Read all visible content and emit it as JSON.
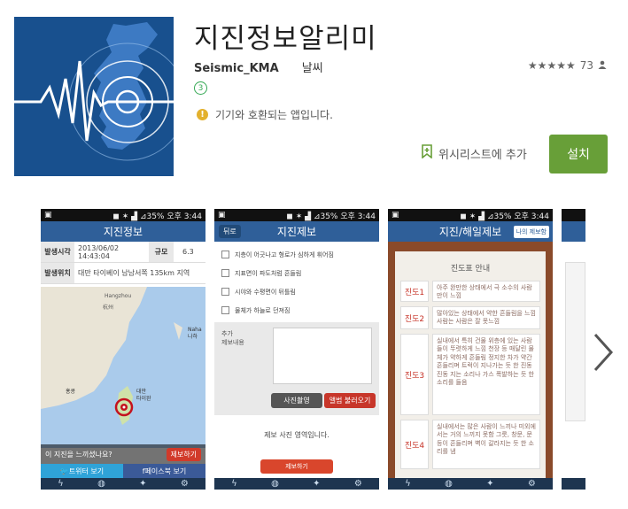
{
  "app": {
    "title": "지진정보알리미",
    "developer": "Seismic_KMA",
    "category": "날씨",
    "rating_stars": "★★★★★",
    "rating_count": "73",
    "age_rating": "3",
    "compat_text": "기기와 호환되는 앱입니다.",
    "wishlist_label": "위시리스트에 추가",
    "install_label": "설치"
  },
  "status_bar": {
    "signal": "◼ ✶ ▟ ⊿35%",
    "time": "오후 3:44"
  },
  "shot1": {
    "title": "지진정보",
    "rows": [
      {
        "label": "발생시각",
        "value": "2013/06/02 14:43:04",
        "label2": "규모",
        "value2": "6.3"
      },
      {
        "label": "발생위치",
        "value": "대만 타이베이 남남서쪽 135km 지역"
      }
    ],
    "map_labels": [
      "Hangzhou",
      "杭州",
      "대만",
      "타이완",
      "홍콩",
      "Naha",
      "나하"
    ],
    "feel_question": "이 지진을 느끼셨나요?",
    "report_label": "제보하기",
    "twitter_label": "트위터 보기",
    "facebook_label": "페이스북 보기"
  },
  "shot2": {
    "back_label": "뒤로",
    "title": "지진제보",
    "checks": [
      "지층이 어긋나고 형로가 심하게 휘어짐",
      "지표면이 파도처럼 흔들림",
      "시야와 수평면이 뒤틀림",
      "물체가 하늘로 던져짐"
    ],
    "add_label": "추가\n제보내용",
    "photo_btn": "사진촬영",
    "album_btn": "앨범 불러오기",
    "no_photo": "제보 사진 영역입니다.",
    "submit_label": "제보하기"
  },
  "shot3": {
    "title": "지진/해일제보",
    "my_report": "나의 제보함",
    "card_title": "진도표 안내",
    "items": [
      {
        "label": "진도1",
        "desc": "아주 완만한 상태에서 극 소수의 사람만이 느낌"
      },
      {
        "label": "진도2",
        "desc": "많아있는 상태에서 약한 흔들림을 느낌 사람는 사람은 잘 못느낌"
      },
      {
        "label": "진도3",
        "desc": "실내에서 특히 건물 위층에 있는 사람들이 뚜렷하게 느낌 천장 등 매달린 물체가 약하게 흔들림 정지한 차가 약간 흔들리며 트럭이 지나가는 듯 한 진동 진동 지는 소리나 가스 폭발하는 듯 한 소리를 들음"
      },
      {
        "label": "진도4",
        "desc": "실내에서는 많은 사람이 느끼나 미외에서는 거의 느끼지 못함 그릇, 창문, 문 등이 흔들리며 벽이 갈라지는 듯 한 소리를 냄"
      }
    ]
  },
  "colors": {
    "install": "#689f38",
    "accent_blue": "#2f5f99",
    "report_red": "#d13a2a"
  }
}
